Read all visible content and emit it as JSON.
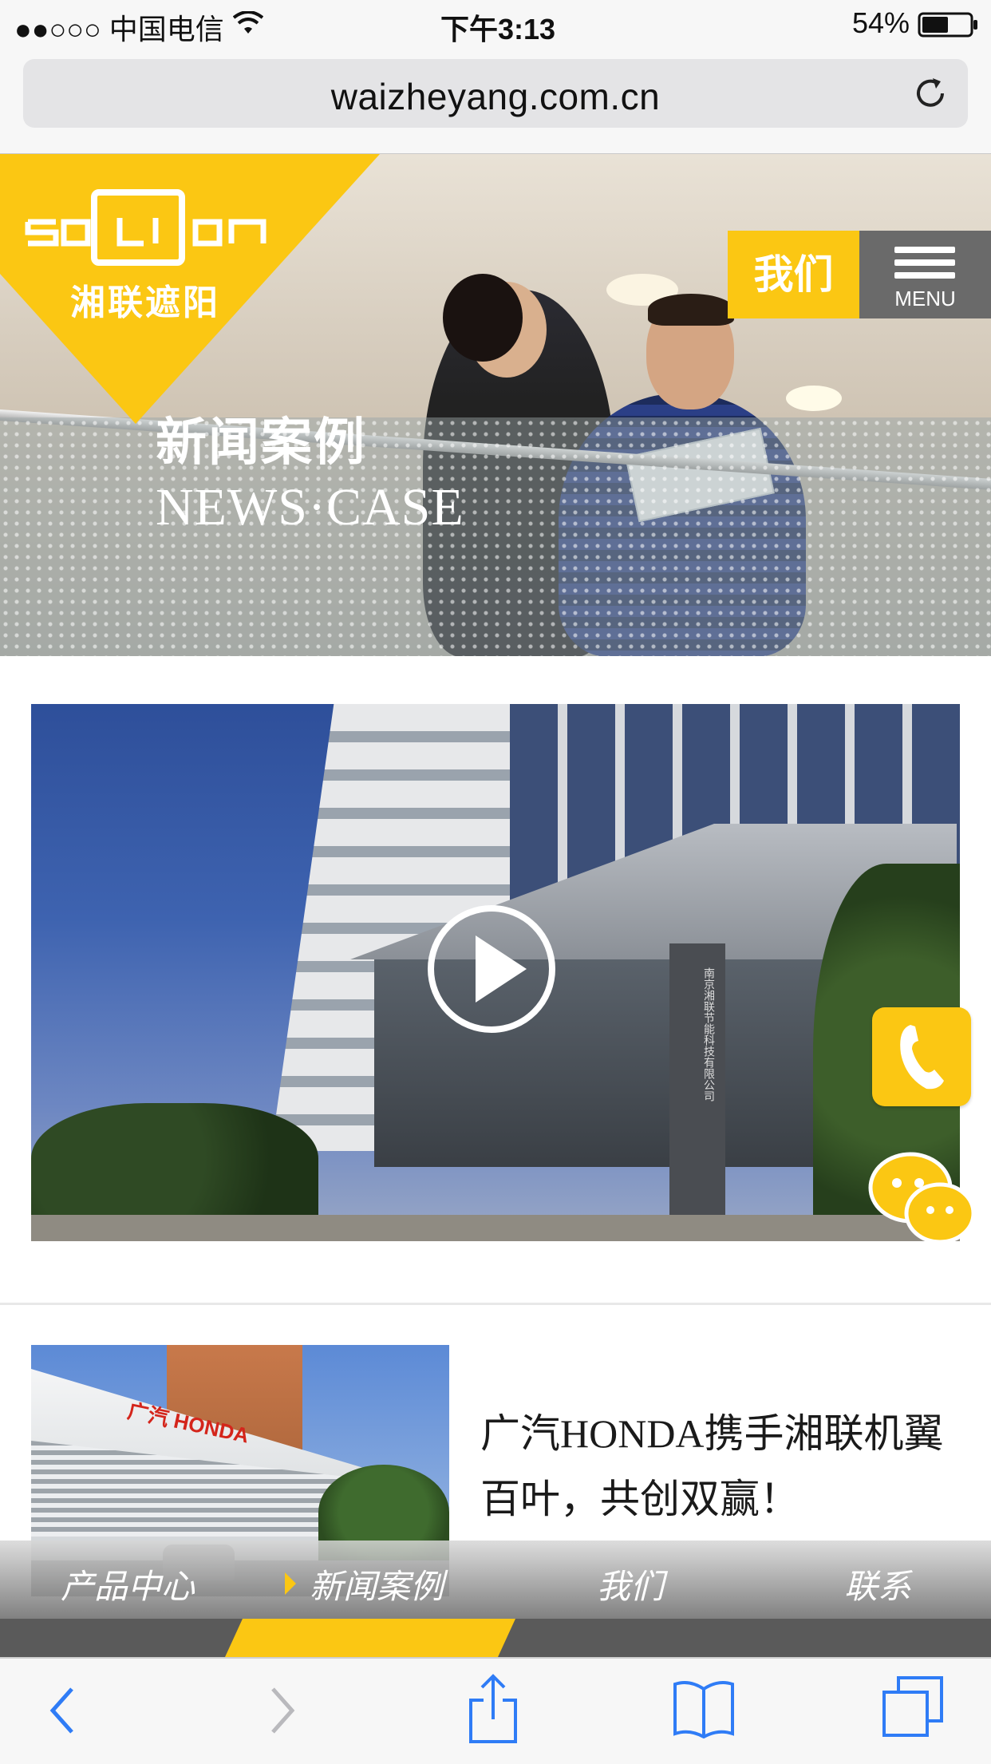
{
  "status_bar": {
    "carrier": "●●○○○ 中国电信",
    "time": "下午3:13",
    "battery": "54%",
    "icons": [
      "wifi-icon",
      "battery-icon"
    ]
  },
  "browser": {
    "url": "waizheyang.com.cn",
    "reload_icon": "reload-icon",
    "toolbar_icons": [
      "back-icon",
      "forward-icon",
      "share-icon",
      "bookmarks-icon",
      "tabs-icon"
    ]
  },
  "hero": {
    "logo_text": "SOLION",
    "logo_cn": "湘联遮阳",
    "title_cn": "新闻案例",
    "title_en": "NEWS·CASE",
    "about_label": "我们",
    "menu_label": "MENU"
  },
  "video": {
    "play_icon": "play-icon",
    "sign_text": "南京湘联节能科技有限公司"
  },
  "news": {
    "title": "广汽HONDA携手湘联机翼百叶，共创双赢！",
    "thumb_brand": "广汽 HONDA"
  },
  "side_buttons": {
    "phone_icon": "phone-icon",
    "chat_icon": "wechat-icon"
  },
  "site_nav": {
    "items": [
      "产品中心",
      "新闻案例",
      "我们",
      "联系"
    ],
    "active_index": 1
  },
  "colors": {
    "accent": "#fbc713",
    "menu_bg": "#6a6a6a"
  }
}
